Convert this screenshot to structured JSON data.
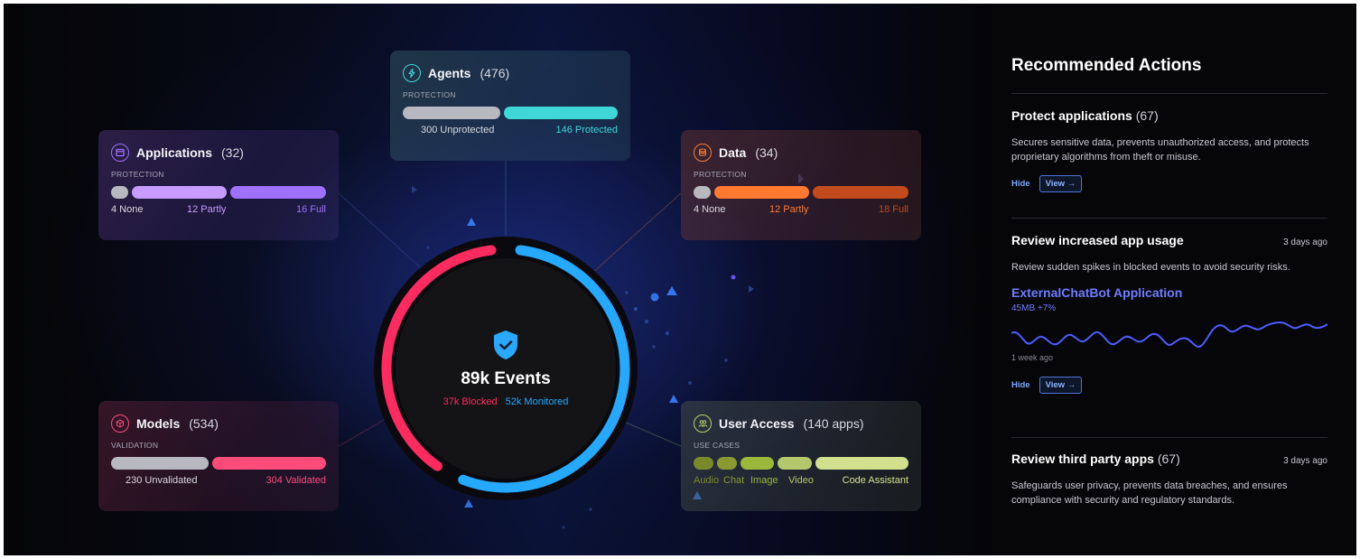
{
  "colors": {
    "blocked": "#ff2a5f",
    "monitored": "#25a9ff",
    "applications_accent": "#a070ff",
    "agents_accent": "#3fd6d6",
    "data_accent": "#ff7a30",
    "models_accent": "#ff4b7a",
    "user_access_accent": "#b7d46a",
    "link": "#6f7cff"
  },
  "cards": {
    "applications": {
      "icon": "window-icon",
      "title": "Applications",
      "count": "(32)",
      "subtitle": "PROTECTION",
      "segments": [
        {
          "label": "4 None",
          "value": 4,
          "color": "#b8b8c0"
        },
        {
          "label": "12 Partly",
          "value": 12,
          "color": "#c79bff"
        },
        {
          "label": "16 Full",
          "value": 16,
          "color": "#a070ff"
        }
      ]
    },
    "agents": {
      "icon": "bolt-icon",
      "title": "Agents",
      "count": "(476)",
      "subtitle": "PROTECTION",
      "segments": [
        {
          "label": "300 Unprotected",
          "value": 300,
          "color": "#b8b8c0"
        },
        {
          "label": "146 Protected",
          "value": 146,
          "color": "#3fd6d6"
        }
      ]
    },
    "data": {
      "icon": "database-icon",
      "title": "Data",
      "count": "(34)",
      "subtitle": "PROTECTION",
      "segments": [
        {
          "label": "4 None",
          "value": 4,
          "color": "#b8b8c0"
        },
        {
          "label": "12 Partly",
          "value": 12,
          "color": "#ff7a30"
        },
        {
          "label": "18 Full",
          "value": 18,
          "color": "#c24a1c"
        }
      ]
    },
    "models": {
      "icon": "cube-icon",
      "title": "Models",
      "count": "(534)",
      "subtitle": "VALIDATION",
      "segments": [
        {
          "label": "230 Unvalidated",
          "value": 230,
          "color": "#b8b8c0"
        },
        {
          "label": "304 Validated",
          "value": 304,
          "color": "#ff4b7a"
        }
      ]
    },
    "user_access": {
      "icon": "users-icon",
      "title": "User Access",
      "count": "(140 apps)",
      "subtitle": "USE CASES",
      "segments": [
        {
          "label": "Audio",
          "color": "#7a8a2a"
        },
        {
          "label": "Chat",
          "color": "#8a9a30"
        },
        {
          "label": "Image",
          "color": "#9cb83a"
        },
        {
          "label": "Video",
          "color": "#b2c86a"
        },
        {
          "label": "Code Assistant",
          "color": "#d2e08e"
        }
      ]
    }
  },
  "center": {
    "icon": "shield-check-icon",
    "title": "89k Events",
    "blocked_label": "37k Blocked",
    "monitored_label": "52k Monitored",
    "blocked_value": 37,
    "monitored_value": 52
  },
  "panel": {
    "title": "Recommended Actions",
    "items": [
      {
        "title": "Protect applications",
        "count": "(67)",
        "time": "",
        "description": "Secures sensitive data, prevents unauthorized access, and protects proprietary algorithms from theft or misuse.",
        "hide_label": "Hide",
        "view_label": "View →"
      },
      {
        "title": "Review increased app usage",
        "count": "",
        "time": "3 days ago",
        "description": "Review sudden spikes in blocked events to avoid security risks.",
        "app_name": "ExternalChatBot Application",
        "app_stat": "45MB +7%",
        "spark_caption": "1 week ago",
        "hide_label": "Hide",
        "view_label": "View →"
      },
      {
        "title": "Review third party apps",
        "count": "(67)",
        "time": "3 days ago",
        "description": "Safeguards user privacy, prevents data breaches, and ensures compliance with security and regulatory standards."
      }
    ]
  }
}
